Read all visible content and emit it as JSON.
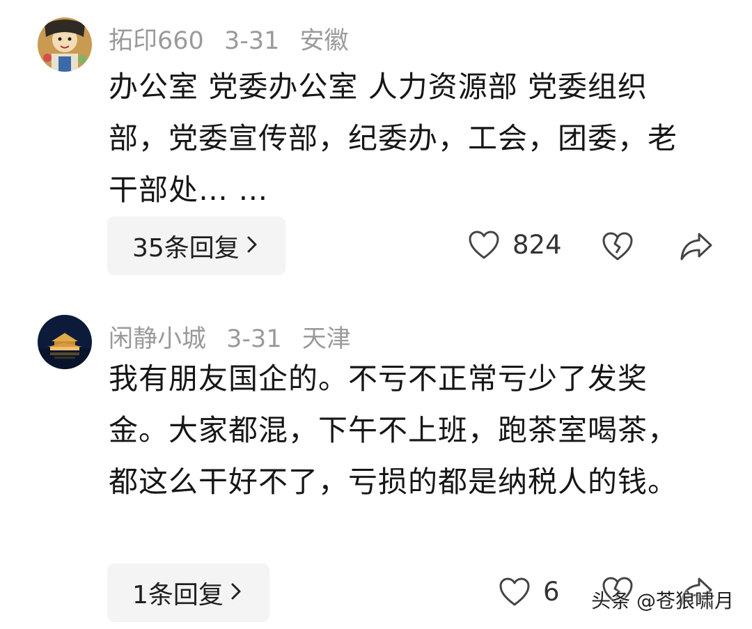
{
  "comments": [
    {
      "username": "拓印660",
      "date": "3-31",
      "location": "安徽",
      "text": "办公室 党委办公室 人力资源部 党委组织部，党委宣传部，纪委办，工会，团委，老干部处… …",
      "replies_label": "35条回复",
      "likes": "824"
    },
    {
      "username": "闲静小城",
      "date": "3-31",
      "location": "天津",
      "text": "我有朋友国企的。不亏不正常亏少了发奖金。大家都混，下午不上班，跑茶室喝茶，都这么干好不了，亏损的都是纳税人的钱。",
      "replies_label": "1条回复",
      "likes": "6"
    }
  ],
  "watermark": "头条 @苍狼啸月",
  "icons": [
    "avatar",
    "heart-icon",
    "broken-heart-icon",
    "share-icon",
    "chevron-right-icon"
  ]
}
